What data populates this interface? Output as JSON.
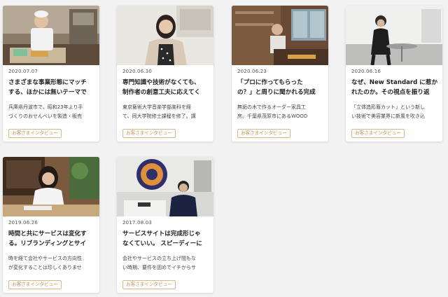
{
  "cards": [
    {
      "date": "2020.07.07",
      "title_lines": [
        "さまざまな事業形態にマッチ",
        "する、ほかには無いテーマで"
      ],
      "excerpt_lines": [
        "兵庫県丹波市で、昭和23年より手",
        "づくりのおせんべいを製造・販売"
      ],
      "tag": "お客さまインタビュー"
    },
    {
      "date": "2020.06.30",
      "title_lines": [
        "専門知識や技術がなくても、",
        "制作者の創意工夫に応えてく"
      ],
      "excerpt_lines": [
        "東京藝術大学音楽学部楽科を経",
        "て、同大学院修士課程を修了。講"
      ],
      "tag": "お客さまインタビュー"
    },
    {
      "date": "2020.06.23",
      "title_lines": [
        "「プロに作ってもらった",
        "の？」と周りに聞かれる完成"
      ],
      "excerpt_lines": [
        "無垢の木で作るオーダー家具工",
        "房。千葉県茂原市にあるWOOD"
      ],
      "tag": "お客さまインタビュー"
    },
    {
      "date": "2020.06.16",
      "title_lines": [
        "なぜ、New Standard に惹か",
        "れたのか。その視点を振り返"
      ],
      "excerpt_lines": [
        "「立体造形眉カット」という新し",
        "い技術で美容業界に新風を吹き込"
      ],
      "tag": "お客さまインタビュー"
    },
    {
      "date": "2019.06.26",
      "title_lines": [
        "時間と共にサービスは変化す",
        "る。リブランディングとサイ"
      ],
      "excerpt_lines": [
        "時を経て会社やサービスの方向性",
        "が変化することは珍しくありませ"
      ],
      "tag": "お客さまインタビュー"
    },
    {
      "date": "2017.08.03",
      "title_lines": [
        "サービスサイトは完成形じゃ",
        "なくていい。 スピーディーに"
      ],
      "excerpt_lines": [
        "会社やサービスの立ち上げ間もな",
        "い時期、要件を固めてイチからサ"
      ],
      "tag": "お客さまインタビュー"
    }
  ]
}
